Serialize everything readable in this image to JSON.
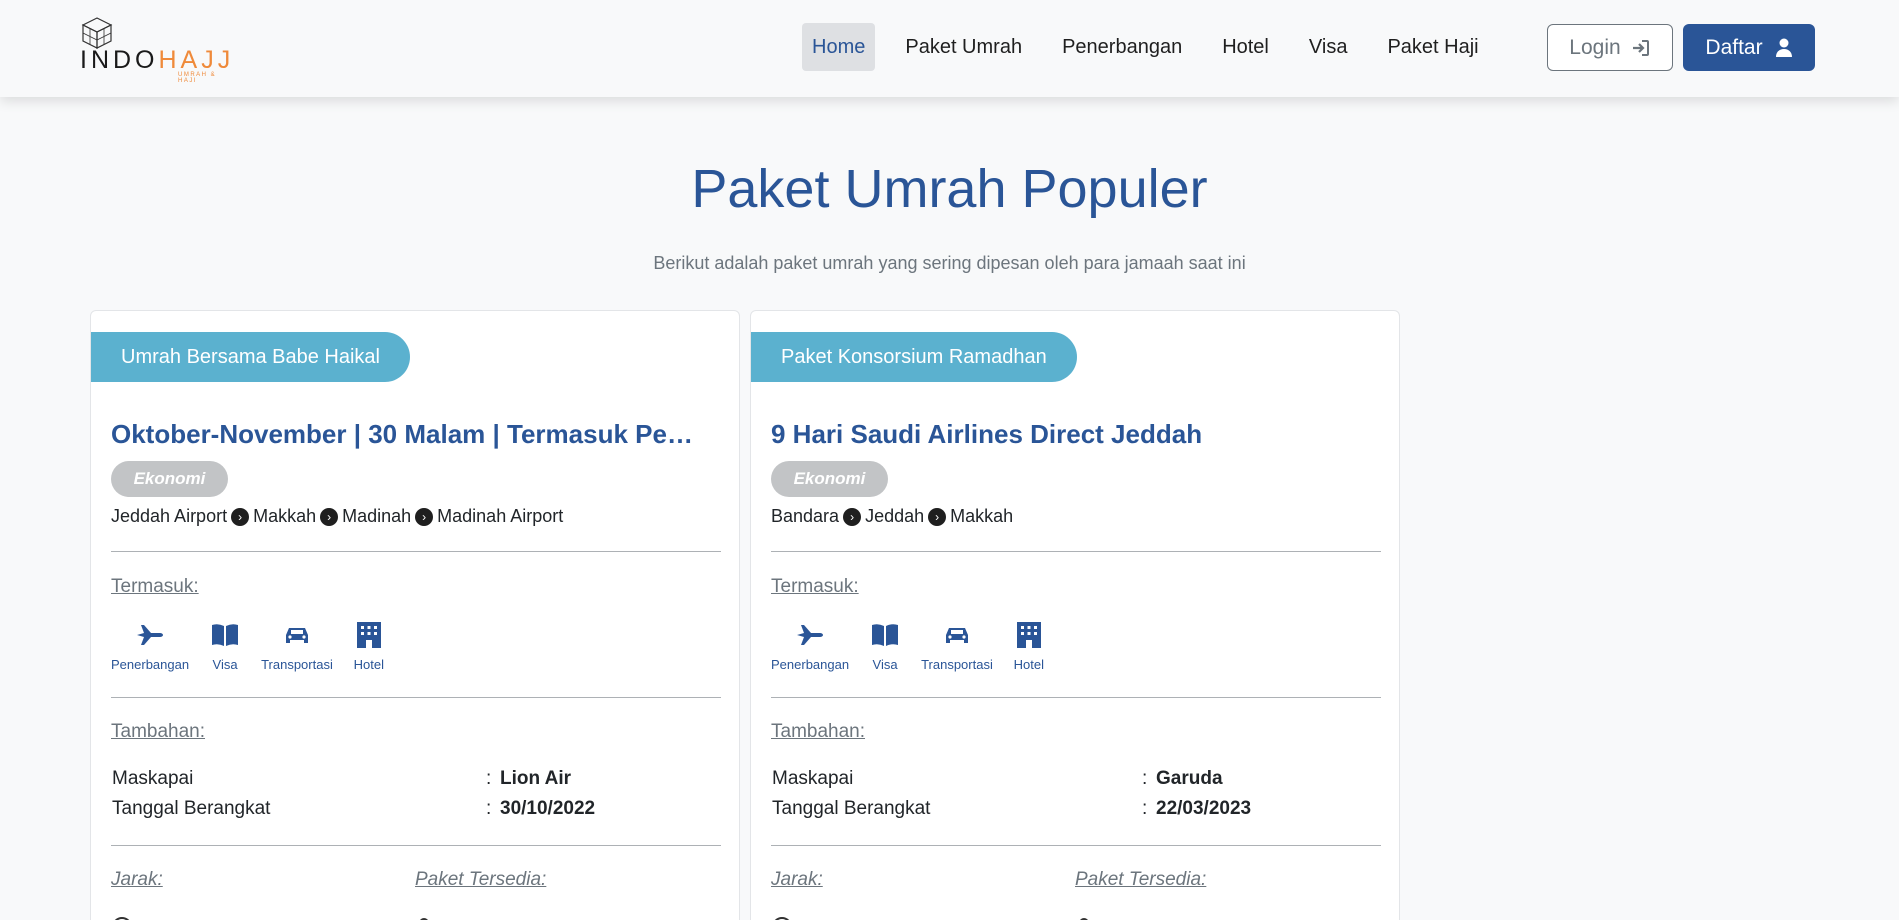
{
  "brand": {
    "name_part1": "INDO",
    "name_part2": "HAJJ",
    "tagline": "UMRAH & HAJI"
  },
  "nav": {
    "items": [
      {
        "label": "Home",
        "active": true
      },
      {
        "label": "Paket Umrah",
        "active": false
      },
      {
        "label": "Penerbangan",
        "active": false
      },
      {
        "label": "Hotel",
        "active": false
      },
      {
        "label": "Visa",
        "active": false
      },
      {
        "label": "Paket Haji",
        "active": false
      }
    ],
    "login_label": "Login",
    "register_label": "Daftar"
  },
  "section": {
    "title": "Paket Umrah Populer",
    "subtitle": "Berikut adalah paket umrah yang sering dipesan oleh para jamaah saat ini"
  },
  "labels": {
    "includes": "Termasuk:",
    "extras": "Tambahan:",
    "airline": "Maskapai",
    "departure": "Tanggal Berangkat",
    "distance": "Jarak:",
    "available": "Paket Tersedia:"
  },
  "packages": [
    {
      "tag": "Umrah Bersama Babe Haikal",
      "title": "Oktober-November | 30 Malam | Termasuk Pe…",
      "class": "Ekonomi",
      "route": [
        "Jeddah Airport",
        "Makkah",
        "Madinah",
        "Madinah Airport"
      ],
      "includes": [
        "Penerbangan",
        "Visa",
        "Transportasi",
        "Hotel"
      ],
      "airline": "Lion Air",
      "departure_date": "30/10/2022"
    },
    {
      "tag": "Paket Konsorsium Ramadhan",
      "title": "9 Hari Saudi Airlines Direct Jeddah",
      "class": "Ekonomi",
      "route": [
        "Bandara",
        "Jeddah",
        "Makkah"
      ],
      "includes": [
        "Penerbangan",
        "Visa",
        "Transportasi",
        "Hotel"
      ],
      "airline": "Garuda",
      "departure_date": "22/03/2023"
    }
  ],
  "colors": {
    "primary": "#2a5597",
    "tag": "#5bb1cf",
    "accent": "#ef8a3a",
    "badge": "#c2c4c6"
  }
}
